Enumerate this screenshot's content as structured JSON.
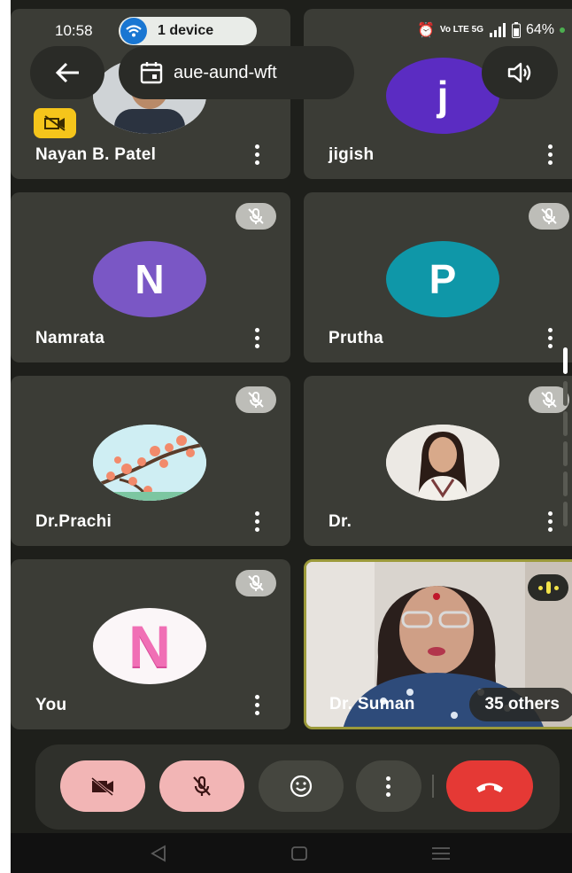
{
  "status_bar": {
    "time": "10:58",
    "device_pill": "1 device",
    "battery": "64%",
    "network": "Vo LTE 5G"
  },
  "header": {
    "meeting_code": "aue-aund-wft"
  },
  "tiles": [
    {
      "name": "Nayan B. Patel",
      "avatar_type": "photo",
      "camera_off_badge": true
    },
    {
      "name": "jigish",
      "avatar_letter": "j",
      "avatar_color": "#5b2cc2"
    },
    {
      "name": "Namrata",
      "avatar_letter": "N",
      "avatar_color": "#7a57c5",
      "muted": true
    },
    {
      "name": "Prutha",
      "avatar_letter": "P",
      "avatar_color": "#0f97a8",
      "muted": true
    },
    {
      "name": "Dr.Prachi",
      "avatar_type": "blossom",
      "muted": true
    },
    {
      "name": "Dr.",
      "avatar_type": "photo",
      "muted": true
    },
    {
      "name": "You",
      "avatar_type": "pink-letter",
      "avatar_letter": "N",
      "muted": true
    },
    {
      "name": "Dr. Suman",
      "video": true,
      "speaking": true,
      "others_label": "35 others"
    }
  ],
  "controls": [
    "camera-off-icon",
    "mic-off-icon",
    "reaction-icon",
    "more-options-icon",
    "end-call-icon"
  ],
  "colors": {
    "tile_bg": "#3b3c36",
    "screen_bg": "#1e1f1b",
    "end_call": "#e53935",
    "off_button": "#f2b5b5",
    "active_speaker_border": "#9c9a3a"
  }
}
